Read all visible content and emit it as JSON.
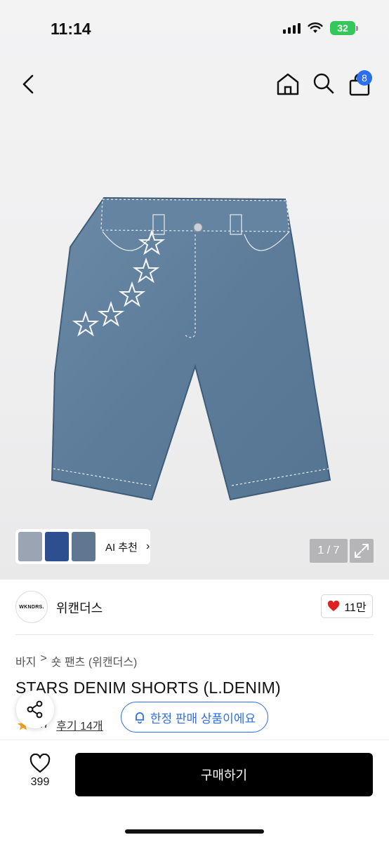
{
  "status_bar": {
    "time": "11:14",
    "battery": "32"
  },
  "nav": {
    "cart_count": "8"
  },
  "gallery": {
    "ai_recommend_label": "AI 추천",
    "page_indicator": "1 / 7",
    "thumbnail_colors": [
      "#9aa4b2",
      "#2d4f8f",
      "#5f7790"
    ]
  },
  "brand": {
    "logo_text": "WKNDRS.",
    "name": "위캔더스",
    "likes": "11만"
  },
  "breadcrumb": {
    "category": "바지",
    "separator": ">",
    "subcategory": "숏 팬츠 (위캔더스)"
  },
  "product": {
    "title": "STARS DENIM SHORTS (L.DENIM)",
    "rating": "4.7",
    "review_label": "후기 14개",
    "limited_label": "한정 판매 상품이에요"
  },
  "bottom": {
    "wish_count": "399",
    "buy_label": "구매하기"
  },
  "colors": {
    "accent": "#2b6fef",
    "heart": "#e02020",
    "star": "#f5a623",
    "denim": "#5f7f9d"
  }
}
